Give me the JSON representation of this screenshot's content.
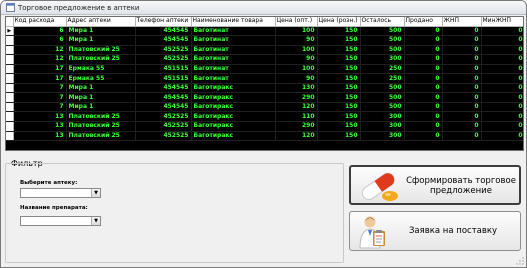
{
  "window": {
    "title": "Торговое предложение в аптеки"
  },
  "grid": {
    "columns": [
      "Код расхода",
      "Адрес аптеки",
      "Телефон аптеки",
      "Наименование товара",
      "Цена (опт.)",
      "Цена (розн.)",
      "Осталось",
      "Продано",
      "ЖНП",
      "МинЖНП"
    ],
    "rows": [
      [
        "6",
        "Мира 1",
        "454545",
        "Баготинат",
        "100",
        "150",
        "500",
        "0",
        "0",
        "0"
      ],
      [
        "6",
        "Мира 1",
        "454545",
        "Баготинат",
        "90",
        "150",
        "500",
        "0",
        "0",
        "0"
      ],
      [
        "12",
        "Платовский 25",
        "452525",
        "Баготинат",
        "100",
        "150",
        "500",
        "0",
        "0",
        "0"
      ],
      [
        "12",
        "Платовский 25",
        "452525",
        "Баготинат",
        "90",
        "150",
        "300",
        "0",
        "0",
        "0"
      ],
      [
        "17",
        "Ермака 55",
        "451515",
        "Баготинат",
        "100",
        "150",
        "250",
        "0",
        "0",
        "0"
      ],
      [
        "17",
        "Ермака 55",
        "451515",
        "Баготинат",
        "90",
        "150",
        "250",
        "0",
        "0",
        "0"
      ],
      [
        "7",
        "Мира 1",
        "454545",
        "Баготиракс",
        "130",
        "150",
        "500",
        "0",
        "0",
        "0"
      ],
      [
        "7",
        "Мира 1",
        "454545",
        "Баготиракс",
        "290",
        "150",
        "500",
        "0",
        "0",
        "0"
      ],
      [
        "7",
        "Мира 1",
        "454545",
        "Баготиракс",
        "120",
        "150",
        "500",
        "0",
        "0",
        "0"
      ],
      [
        "13",
        "Платовский 25",
        "452525",
        "Баготиракс",
        "110",
        "150",
        "300",
        "0",
        "0",
        "0"
      ],
      [
        "13",
        "Платовский 25",
        "452525",
        "Баготиракс",
        "290",
        "150",
        "300",
        "0",
        "0",
        "0"
      ],
      [
        "13",
        "Платовский 25",
        "452525",
        "Баготиракс",
        "120",
        "150",
        "300",
        "0",
        "0",
        "0"
      ]
    ],
    "current_row_marker": "▶"
  },
  "filter": {
    "title": "Фильтр",
    "pharmacy_label": "Выберите аптеку:",
    "product_label": "Название препарата:",
    "dropdown_arrow": "▼"
  },
  "buttons": {
    "make_offer": "Сформировать торговое предложение",
    "supply_request": "Заявка на поставку"
  },
  "colors": {
    "grid_background": "#000000",
    "grid_text": "#3cff3c",
    "window_background": "#f0f0f0"
  },
  "icons": {
    "title": "app-icon",
    "make_offer": "pills-icon",
    "supply_request": "doctor-clipboard-icon"
  }
}
